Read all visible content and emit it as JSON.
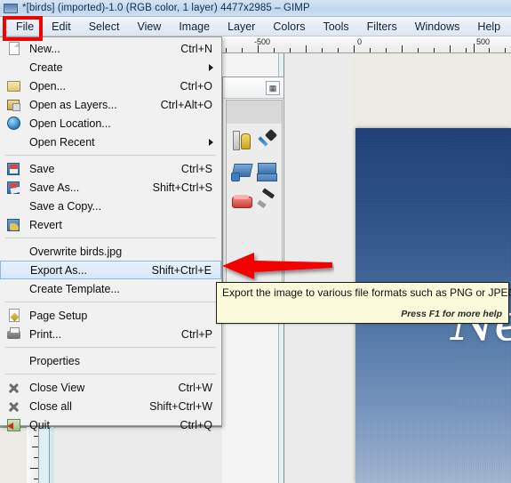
{
  "window": {
    "title": "*[birds] (imported)-1.0 (RGB color, 1 layer) 4477x2985 – GIMP",
    "icon": "gimp-window-icon"
  },
  "menubar": {
    "items": [
      {
        "label": "File"
      },
      {
        "label": "Edit"
      },
      {
        "label": "Select"
      },
      {
        "label": "View"
      },
      {
        "label": "Image"
      },
      {
        "label": "Layer"
      },
      {
        "label": "Colors"
      },
      {
        "label": "Tools"
      },
      {
        "label": "Filters"
      },
      {
        "label": "Windows"
      },
      {
        "label": "Help"
      }
    ]
  },
  "file_menu": {
    "items": [
      {
        "label": "New...",
        "accel": "Ctrl+N",
        "icon": "new-document-icon",
        "submenu": false,
        "selected": false
      },
      {
        "label": "Create",
        "accel": "",
        "icon": "",
        "submenu": true,
        "selected": false
      },
      {
        "label": "Open...",
        "accel": "Ctrl+O",
        "icon": "open-folder-icon",
        "submenu": false,
        "selected": false
      },
      {
        "label": "Open as Layers...",
        "accel": "Ctrl+Alt+O",
        "icon": "open-as-layers-icon",
        "submenu": false,
        "selected": false
      },
      {
        "label": "Open Location...",
        "accel": "",
        "icon": "globe-icon",
        "submenu": false,
        "selected": false
      },
      {
        "label": "Open Recent",
        "accel": "",
        "icon": "",
        "submenu": true,
        "selected": false
      },
      {
        "label": "Save",
        "accel": "Ctrl+S",
        "icon": "save-floppy-icon",
        "submenu": false,
        "selected": false
      },
      {
        "label": "Save As...",
        "accel": "Shift+Ctrl+S",
        "icon": "save-as-floppy-icon",
        "submenu": false,
        "selected": false
      },
      {
        "label": "Save a Copy...",
        "accel": "",
        "icon": "",
        "submenu": false,
        "selected": false
      },
      {
        "label": "Revert",
        "accel": "",
        "icon": "revert-icon",
        "submenu": false,
        "selected": false
      },
      {
        "label": "Overwrite birds.jpg",
        "accel": "",
        "icon": "",
        "submenu": false,
        "selected": false
      },
      {
        "label": "Export As...",
        "accel": "Shift+Ctrl+E",
        "icon": "",
        "submenu": false,
        "selected": true
      },
      {
        "label": "Create Template...",
        "accel": "",
        "icon": "",
        "submenu": false,
        "selected": false
      },
      {
        "label": "Page Setup",
        "accel": "",
        "icon": "page-setup-icon",
        "submenu": false,
        "selected": false
      },
      {
        "label": "Print...",
        "accel": "Ctrl+P",
        "icon": "printer-icon",
        "submenu": false,
        "selected": false
      },
      {
        "label": "Properties",
        "accel": "",
        "icon": "",
        "submenu": false,
        "selected": false
      },
      {
        "label": "Close View",
        "accel": "Ctrl+W",
        "icon": "close-x-icon",
        "submenu": false,
        "selected": false
      },
      {
        "label": "Close all",
        "accel": "Shift+Ctrl+W",
        "icon": "close-x-icon",
        "submenu": false,
        "selected": false
      },
      {
        "label": "Quit",
        "accel": "Ctrl+Q",
        "icon": "quit-exit-icon",
        "submenu": false,
        "selected": false
      }
    ]
  },
  "tooltip": {
    "text": "Export the image to various file formats such as PNG or JPEG",
    "help": "Press F1 for more help"
  },
  "ruler": {
    "labels": [
      "-500",
      "0",
      "500"
    ]
  },
  "toolbox": {
    "close_button": "configure-tab-icon",
    "tools": [
      {
        "name": "measure-tool"
      },
      {
        "name": "color-picker-tool"
      },
      {
        "name": "perspective-clone-tool"
      },
      {
        "name": "perspective-tool"
      },
      {
        "name": "eraser-tool"
      },
      {
        "name": "airbrush-tool"
      }
    ]
  },
  "image": {
    "text_overlay": "\"Ne"
  },
  "annotations": {
    "file_box": "red-rectangle-file-menu",
    "arrow": "red-arrow-pointing-export-as"
  },
  "colors": {
    "annotation_red": "#f40000",
    "tooltip_bg": "#fbfbdc",
    "menu_bg": "#f1f1f1",
    "selected_row": "#d6e7fa",
    "titlebar": "#c6daf0"
  }
}
